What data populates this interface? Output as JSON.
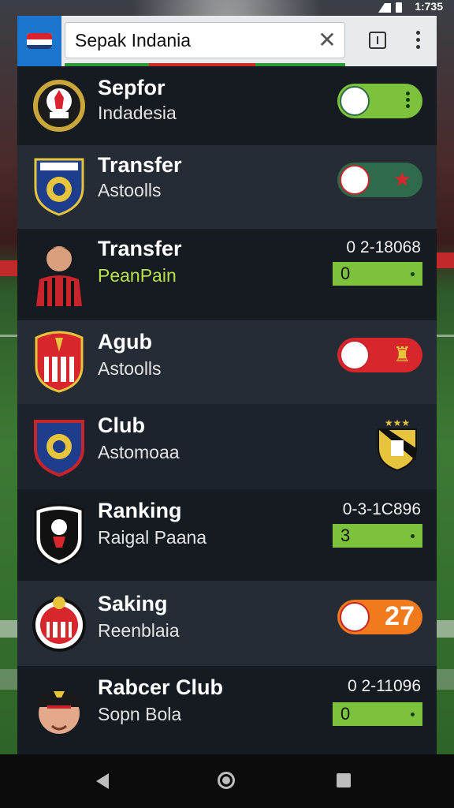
{
  "status_bar": {
    "time": "1:735"
  },
  "search": {
    "query": "Sepak Indania",
    "clear_icon": "close-icon"
  },
  "rows": [
    {
      "title": "Sepfor",
      "subtitle": "Indadesia",
      "right": {
        "type": "pill",
        "color": "#7dc23c",
        "icon": "kebab-icon"
      }
    },
    {
      "title": "Transfer",
      "subtitle": "Astoolls",
      "right": {
        "type": "pill",
        "color": "#2f6a4a",
        "icon": "star-icon"
      }
    },
    {
      "title": "Transfer",
      "subtitle": "PeanPain",
      "score": "0  2-18068",
      "bar_value": "0"
    },
    {
      "title": "Agub",
      "subtitle": "Astoolls",
      "right": {
        "type": "pill",
        "color": "#d7262c",
        "icon": "trophy-icon"
      }
    },
    {
      "title": "Club",
      "subtitle": "Astomoaa",
      "right": {
        "type": "crest"
      }
    },
    {
      "title": "Ranking",
      "subtitle": "Raigal Paana",
      "score": "0-3-1C896",
      "bar_value": "3"
    },
    {
      "title": "Saking",
      "subtitle": "Reenblaia",
      "right": {
        "type": "pill",
        "color": "#f07a1c",
        "value": "27"
      }
    },
    {
      "title": "Rabcer Club",
      "subtitle": "Sopn Bola",
      "score": "0  2-11096",
      "bar_value": "0"
    }
  ]
}
